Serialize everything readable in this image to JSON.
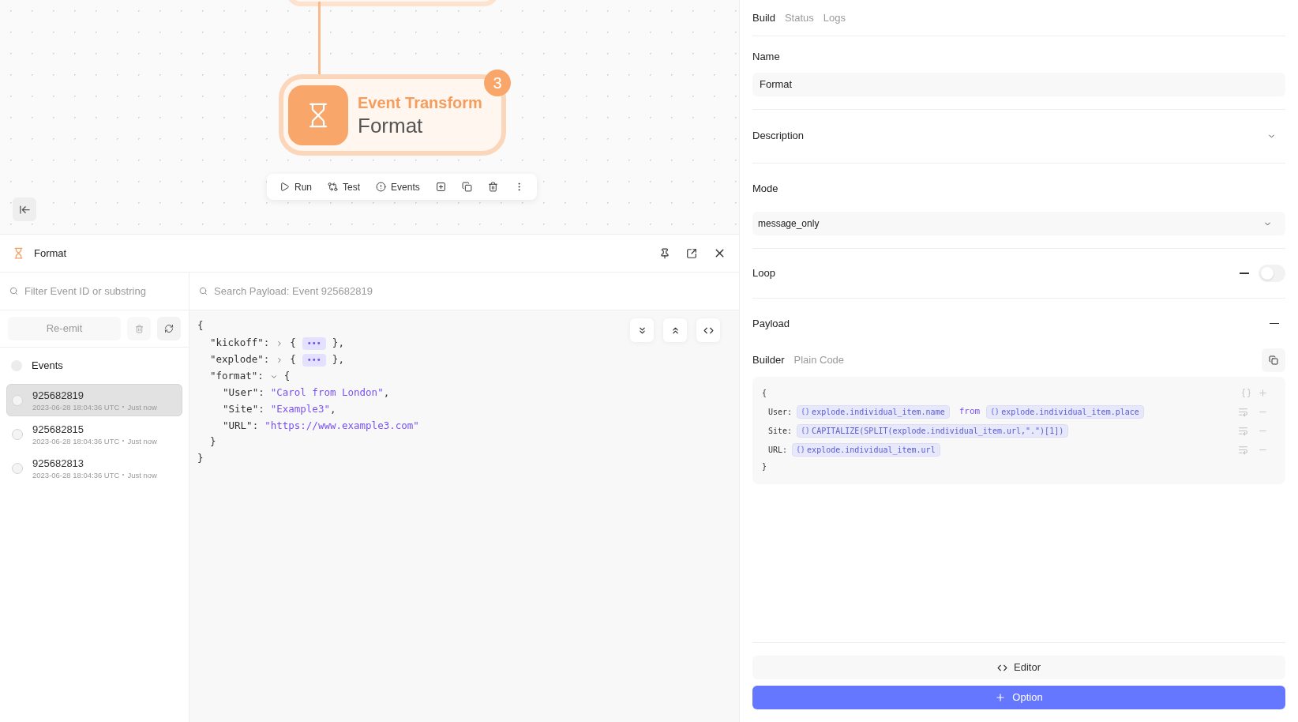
{
  "canvas": {
    "node": {
      "type": "Event Transform",
      "name": "Format",
      "badge": "3"
    },
    "toolbar": [
      {
        "kind": "run",
        "label": "Run"
      },
      {
        "kind": "test",
        "label": "Test"
      },
      {
        "kind": "events",
        "label": "Events"
      },
      {
        "kind": "export"
      },
      {
        "kind": "copy"
      },
      {
        "kind": "delete"
      },
      {
        "kind": "more"
      }
    ]
  },
  "panel": {
    "title": "Format",
    "filter": {
      "placeholder": "Filter Event ID or substring"
    },
    "search": {
      "placeholder": "Search Payload: Event 925682819"
    },
    "reemit": "Re-emit",
    "events_label": "Events",
    "all_checked": false,
    "events": [
      {
        "id": "925682819",
        "time": "2023-06-28 18:04:36 UTC",
        "ago": "Just now",
        "selected": true,
        "checked": false
      },
      {
        "id": "925682815",
        "time": "2023-06-28 18:04:36 UTC",
        "ago": "Just now",
        "selected": false,
        "checked": false
      },
      {
        "id": "925682813",
        "time": "2023-06-28 18:04:36 UTC",
        "ago": "Just now",
        "selected": false,
        "checked": false
      }
    ],
    "payload": {
      "open": "{",
      "close": "}",
      "fields": [
        {
          "key": "\"kickoff\":",
          "expanded": false,
          "open": "{",
          "ellipsis": "•••",
          "close": "},"
        },
        {
          "key": "\"explode\":",
          "expanded": false,
          "open": "{",
          "ellipsis": "•••",
          "close": "},"
        },
        {
          "key": "\"format\":",
          "expanded": true,
          "open": "{",
          "close": "}",
          "children": [
            {
              "key": "\"User\":",
              "value": "\"Carol from London\"",
              "comma": ","
            },
            {
              "key": "\"Site\":",
              "value": "\"Example3\"",
              "comma": ","
            },
            {
              "key": "\"URL\":",
              "value": "\"https://www.example3.com\""
            }
          ]
        }
      ]
    }
  },
  "inspector": {
    "tabs": [
      {
        "label": "Build",
        "selected": true
      },
      {
        "label": "Status",
        "selected": false
      },
      {
        "label": "Logs",
        "selected": false
      }
    ],
    "name": {
      "label": "Name",
      "value": "Format"
    },
    "description": {
      "label": "Description",
      "expanded": false
    },
    "mode": {
      "label": "Mode",
      "value": "message_only"
    },
    "loop": {
      "label": "Loop",
      "on": false
    },
    "payload": {
      "label": "Payload",
      "tabs": [
        {
          "label": "Builder",
          "selected": true
        },
        {
          "label": "Plain Code",
          "selected": false
        }
      ],
      "open": "{",
      "close": "}",
      "rows": [
        {
          "key": "User:",
          "parts": [
            {
              "kind": "expr",
              "text": "explode.individual_item.name"
            },
            {
              "kind": "text",
              "text": "from"
            },
            {
              "kind": "expr",
              "text": "explode.individual_item.place"
            }
          ]
        },
        {
          "key": "Site:",
          "parts": [
            {
              "kind": "expr",
              "text": "CAPITALIZE(SPLIT(explode.individual_item.url,\".\")[1])"
            }
          ]
        },
        {
          "key": "URL:",
          "parts": [
            {
              "kind": "expr",
              "text": "explode.individual_item.url"
            }
          ]
        }
      ]
    },
    "editor_button": "Editor",
    "option_button": "Option"
  }
}
